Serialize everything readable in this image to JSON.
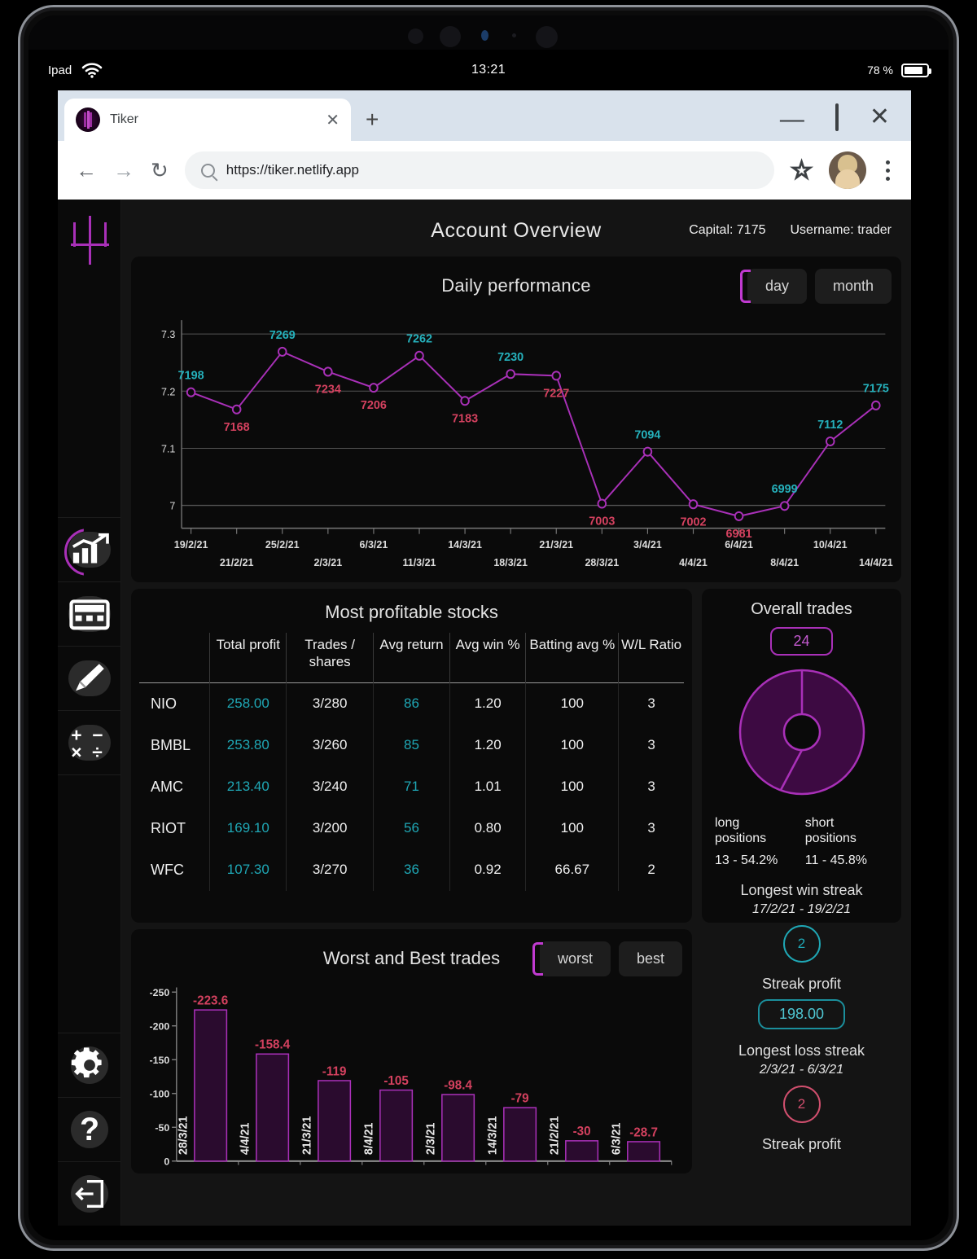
{
  "device": {
    "status_bar": {
      "carrier": "Ipad",
      "wifi_icon": "wifi-icon",
      "time": "13:21",
      "battery_pct": "78 %"
    }
  },
  "browser": {
    "tab": {
      "title": "Tiker",
      "favicon": "tiker-logo-icon",
      "close_label": "✕"
    },
    "new_tab_label": "+",
    "window_controls": {
      "minimize": "—",
      "maximize": "□",
      "close": "✕"
    },
    "toolbar": {
      "back": "←",
      "forward": "→",
      "reload": "↻",
      "url": "https://tiker.netlify.app",
      "bookmark_icon": "star-icon",
      "profile_icon": "avatar",
      "menu_icon": "kebab-menu-icon"
    }
  },
  "sidebar": {
    "logo": "tiker-logo",
    "items": [
      {
        "name": "dashboard",
        "icon": "chart-growth-icon",
        "active": true
      },
      {
        "name": "journal",
        "icon": "calendar-table-icon",
        "active": false
      },
      {
        "name": "notes",
        "icon": "pencil-icon",
        "active": false
      },
      {
        "name": "calculator",
        "icon": "calculator-icon",
        "active": false
      },
      {
        "name": "settings",
        "icon": "gear-icon",
        "active": false
      },
      {
        "name": "help",
        "icon": "question-mark-icon",
        "active": false
      },
      {
        "name": "logout",
        "icon": "logout-icon",
        "active": false
      }
    ]
  },
  "header": {
    "title": "Account Overview",
    "capital": "Capital: 7175",
    "username": "Username: trader"
  },
  "performance_card": {
    "title": "Daily performance",
    "toggle": {
      "options": [
        "day",
        "month"
      ],
      "selected": "day"
    }
  },
  "stocks_card": {
    "title": "Most profitable stocks",
    "columns": [
      "",
      "Total profit",
      "Trades / shares",
      "Avg return",
      "Avg win %",
      "Batting avg %",
      "W/L Ratio"
    ],
    "rows": [
      {
        "symbol": "NIO",
        "total_profit": "258.00",
        "trades_shares": "3/280",
        "avg_return": "86",
        "avg_win": "1.20",
        "batting_avg": "100",
        "wl_ratio": "3"
      },
      {
        "symbol": "BMBL",
        "total_profit": "253.80",
        "trades_shares": "3/260",
        "avg_return": "85",
        "avg_win": "1.20",
        "batting_avg": "100",
        "wl_ratio": "3"
      },
      {
        "symbol": "AMC",
        "total_profit": "213.40",
        "trades_shares": "3/240",
        "avg_return": "71",
        "avg_win": "1.01",
        "batting_avg": "100",
        "wl_ratio": "3"
      },
      {
        "symbol": "RIOT",
        "total_profit": "169.10",
        "trades_shares": "3/200",
        "avg_return": "56",
        "avg_win": "0.80",
        "batting_avg": "100",
        "wl_ratio": "3"
      },
      {
        "symbol": "WFC",
        "total_profit": "107.30",
        "trades_shares": "3/270",
        "avg_return": "36",
        "avg_win": "0.92",
        "batting_avg": "66.67",
        "wl_ratio": "2"
      }
    ]
  },
  "overall_card": {
    "title": "Overall trades",
    "total_trades": "24",
    "long_label_line1": "long",
    "long_label_line2": "positions",
    "long_value": "13 - 54.2%",
    "short_label_line1": "short",
    "short_label_line2": "positions",
    "short_value": "11 - 45.8%",
    "win_streak_title": "Longest win streak",
    "win_streak_dates": "17/2/21 - 19/2/21",
    "win_streak_count": "2",
    "win_streak_profit_label": "Streak profit",
    "win_streak_profit": "198.00",
    "loss_streak_title": "Longest loss streak",
    "loss_streak_dates": "2/3/21 - 6/3/21",
    "loss_streak_count": "2",
    "loss_streak_profit_label": "Streak profit"
  },
  "trades_card": {
    "title": "Worst and Best trades",
    "toggle": {
      "options": [
        "worst",
        "best"
      ],
      "selected": "worst"
    }
  },
  "colors": {
    "accent_purple": "#a930b8",
    "accent_magenta": "#c03ad0",
    "positive_teal": "#25b0bb",
    "negative_pink": "#d4415f",
    "card_bg": "#0a0a0a",
    "app_bg": "#141414"
  },
  "chart_data": [
    {
      "type": "line",
      "title": "Daily performance",
      "xlabel": "",
      "ylabel": "",
      "ylim": [
        6960,
        7310
      ],
      "yticks": [
        7000,
        7100,
        7200,
        7300
      ],
      "ytick_labels": [
        "7",
        "7.1",
        "7.2",
        "7.3"
      ],
      "grid": true,
      "legend": "none",
      "x": [
        "19/2/21",
        "21/2/21",
        "25/2/21",
        "2/3/21",
        "6/3/21",
        "11/3/21",
        "14/3/21",
        "18/3/21",
        "21/3/21",
        "28/3/21",
        "3/4/21",
        "4/4/21",
        "6/4/21",
        "8/4/21",
        "10/4/21",
        "14/4/21"
      ],
      "values": [
        7198,
        7168,
        7269,
        7234,
        7206,
        7262,
        7183,
        7230,
        7227,
        7003,
        7094,
        7002,
        6981,
        6999,
        7112,
        7175
      ],
      "point_label_colors": [
        "pos",
        "neg",
        "pos",
        "neg",
        "neg",
        "pos",
        "neg",
        "pos",
        "neg",
        "neg",
        "pos",
        "neg",
        "neg",
        "pos",
        "pos",
        "pos"
      ],
      "line_color": "#a930b8"
    },
    {
      "type": "bar",
      "title": "Worst and Best trades",
      "xlabel": "",
      "ylabel": "",
      "ylim": [
        -250,
        0
      ],
      "yticks": [
        0,
        -50,
        -100,
        -150,
        -200,
        -250
      ],
      "ytick_labels": [
        "0",
        "-50",
        "-100",
        "-150",
        "-200",
        "-250"
      ],
      "grid": false,
      "categories": [
        "28/3/21",
        "4/4/21",
        "21/3/21",
        "8/4/21",
        "2/3/21",
        "14/3/21",
        "21/2/21",
        "6/3/21"
      ],
      "values": [
        -223.6,
        -158.4,
        -119,
        -105,
        -98.4,
        -79,
        -30,
        -28.7
      ],
      "value_labels": [
        "-223.6",
        "-158.4",
        "-119",
        "-105",
        "-98.4",
        "-79",
        "-30",
        "-28.7"
      ],
      "bar_fill": "#2a0b2e",
      "bar_stroke": "#a930b8",
      "label_color": "#d4415f"
    },
    {
      "type": "pie",
      "title": "Overall trades",
      "labels": [
        "long positions",
        "short positions"
      ],
      "values": [
        13,
        11
      ],
      "percentages": [
        54.2,
        45.8
      ],
      "center_value": "24",
      "colors": [
        "#3d0a42",
        "#3d0a42"
      ],
      "stroke": "#a930b8",
      "donut": true
    }
  ]
}
